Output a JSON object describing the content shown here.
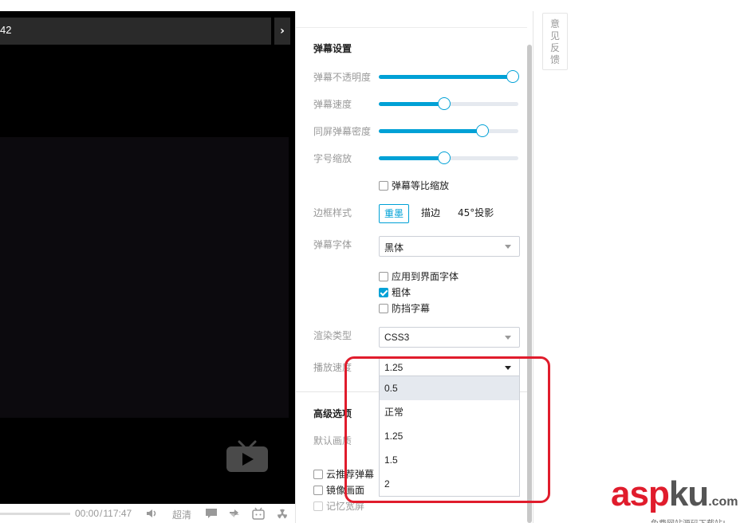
{
  "player": {
    "title_fragment": "42",
    "next_glyph": "›",
    "time_current": "00:00",
    "time_separator": "/",
    "time_total": "117:47",
    "quality_label": "超清",
    "icons": [
      "volume-icon",
      "danmaku-icon",
      "loop-icon",
      "bilibili-tv-icon",
      "radiation-icon"
    ]
  },
  "danmaku_settings": {
    "title": "弹幕设置",
    "sliders": [
      {
        "label": "弹幕不透明度",
        "value": 0.96
      },
      {
        "label": "弹幕速度",
        "value": 0.47
      },
      {
        "label": "同屏弹幕密度",
        "value": 0.74
      },
      {
        "label": "字号缩放",
        "value": 0.47
      }
    ],
    "proportional_scale_label": "弹幕等比缩放",
    "proportional_scale_checked": false,
    "border_style_label": "边框样式",
    "border_options": [
      "重墨",
      "描边",
      "45°投影"
    ],
    "border_selected": "重墨",
    "font_label": "弹幕字体",
    "font_value": "黑体",
    "font_options": [
      {
        "label": "应用到界面字体",
        "checked": false
      },
      {
        "label": "粗体",
        "checked": true
      },
      {
        "label": "防挡字幕",
        "checked": false
      }
    ],
    "render_label": "渲染类型",
    "render_value": "CSS3",
    "speed_label": "播放速度",
    "speed_value": "1.25",
    "speed_options": [
      "0.5",
      "正常",
      "1.25",
      "1.5",
      "2"
    ],
    "speed_hovered": "0.5"
  },
  "advanced": {
    "title": "高级选项",
    "default_quality_label": "默认画质",
    "checkboxes": [
      {
        "label": "云推荐弹幕",
        "checked": false
      },
      {
        "label": "镜像画面",
        "checked": false
      },
      {
        "label": "记忆宽屏",
        "checked": false
      }
    ]
  },
  "feedback": {
    "chars": [
      "意",
      "见",
      "反",
      "馈"
    ]
  },
  "watermark": {
    "brand_a": "asp",
    "brand_b": "ku",
    "brand_c": ".com",
    "sub": "免费网站源码下载站!"
  },
  "colors": {
    "accent": "#00a1d6",
    "highlight": "#e01c2c",
    "player_bg": "#000000"
  }
}
